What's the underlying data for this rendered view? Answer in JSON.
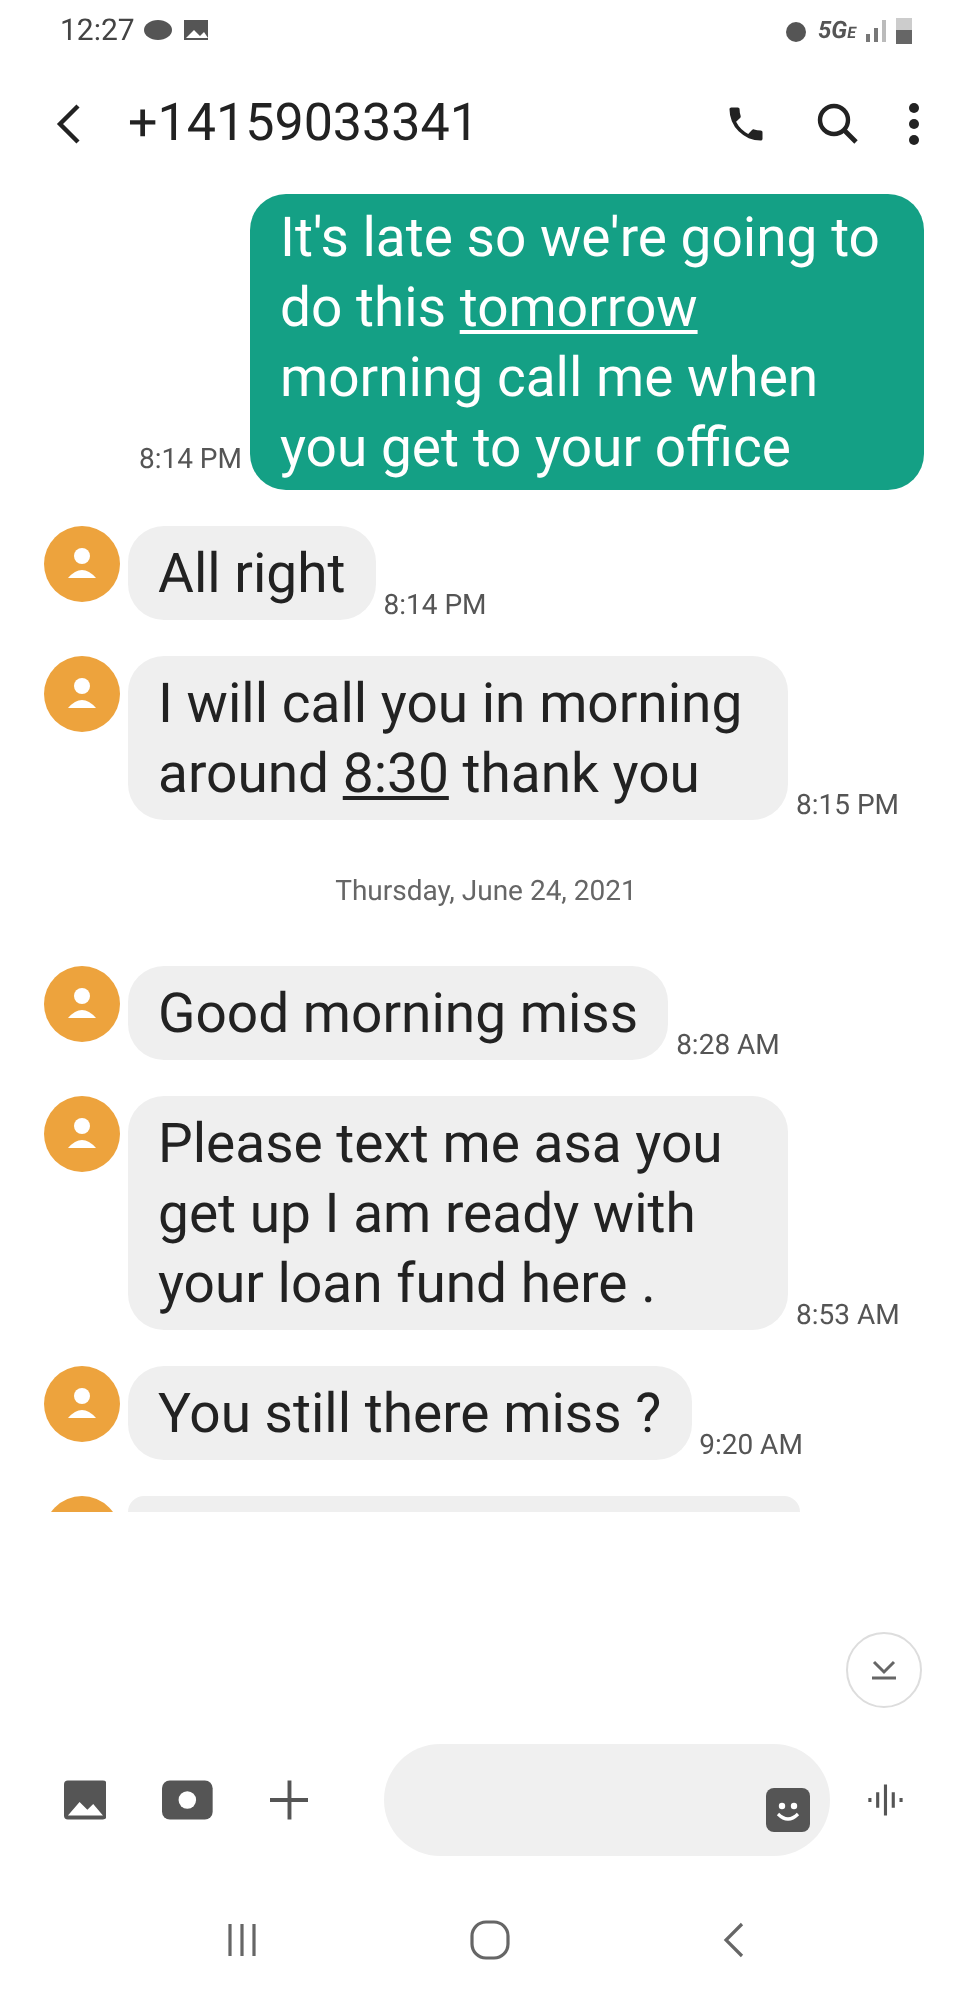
{
  "status_bar": {
    "time": "12:27",
    "network": "5G",
    "network_sub": "E"
  },
  "header": {
    "title": "+14159033341"
  },
  "messages": [
    {
      "kind": "sent",
      "time": "8:14 PM",
      "parts": [
        {
          "text": "It's late so we're going to do this "
        },
        {
          "text": "tomorrow",
          "link": true
        },
        {
          "text": " morning call me when you get to your office"
        }
      ]
    },
    {
      "kind": "received",
      "time": "8:14 PM",
      "parts": [
        {
          "text": "All right"
        }
      ]
    },
    {
      "kind": "received",
      "time": "8:15 PM",
      "parts": [
        {
          "text": "I will call you in morning around "
        },
        {
          "text": "8:30",
          "link": true
        },
        {
          "text": " thank you"
        }
      ]
    },
    {
      "kind": "date",
      "text": "Thursday, June 24, 2021"
    },
    {
      "kind": "received",
      "time": "8:28 AM",
      "parts": [
        {
          "text": "Good morning miss"
        }
      ]
    },
    {
      "kind": "received",
      "time": "8:53 AM",
      "parts": [
        {
          "text": "Please text me asa you get up I am ready with your loan fund here ."
        }
      ]
    },
    {
      "kind": "received",
      "time": "9:20 AM",
      "parts": [
        {
          "text": "You still there miss ?"
        }
      ]
    },
    {
      "kind": "partial"
    }
  ]
}
